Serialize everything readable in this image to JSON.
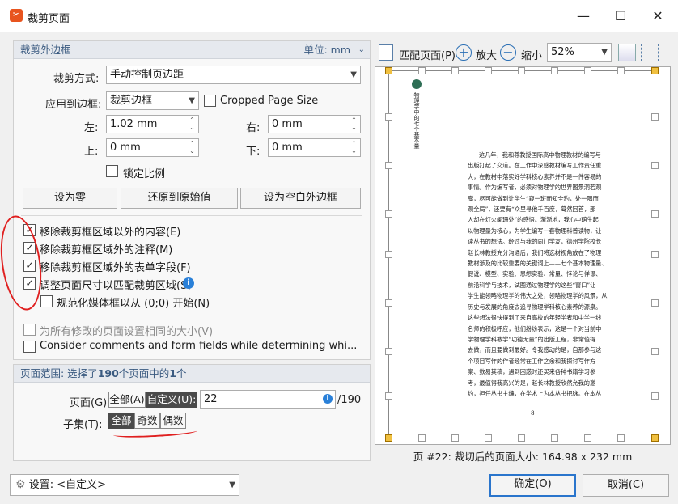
{
  "window": {
    "title": "裁剪页面",
    "minimize": "—",
    "maximize": "☐",
    "close": "✕",
    "app_icon": "foxit-icon"
  },
  "margins": {
    "header": "裁剪外边框",
    "unit_label": "单位:",
    "unit_value": "mm",
    "crop_mode_label": "裁剪方式:",
    "crop_mode_value": "手动控制页边距",
    "apply_to_label": "应用到边框:",
    "apply_to_value": "裁剪边框",
    "cropped_page_size_label": "Cropped Page Size",
    "left_label": "左:",
    "left_value": "1.02 mm",
    "right_label": "右:",
    "right_value": "0 mm",
    "top_label": "上:",
    "top_value": "0 mm",
    "bottom_label": "下:",
    "bottom_value": "0 mm",
    "lock_ratio_label": "锁定比例",
    "set_zero": "设为零",
    "revert": "还原到原始值",
    "set_to_white": "设为空白外边框"
  },
  "options": [
    {
      "label": "移除裁剪框区域以外的内容(E)",
      "checked": true,
      "disabled": false
    },
    {
      "label": "移除裁剪框区域外的注释(M)",
      "checked": true,
      "disabled": false
    },
    {
      "label": "移除裁剪框区域外的表单字段(F)",
      "checked": true,
      "disabled": false
    },
    {
      "label": "调整页面尺寸以匹配裁剪区域(S)",
      "checked": true,
      "disabled": false
    },
    {
      "label": "规范化媒体框以从 (0;0) 开始(N)",
      "checked": false,
      "disabled": false
    },
    {
      "label": "为所有修改的页面设置相同的大小(V)",
      "checked": false,
      "disabled": true
    },
    {
      "label": "Consider comments and form fields while determining whi...",
      "checked": false,
      "disabled": false
    }
  ],
  "range": {
    "header_prefix": "页面范围: 选择了",
    "header_count": "190",
    "header_mid": "个页面中的",
    "header_sel": "1",
    "header_suffix": "个",
    "pages_label": "页面(G):",
    "all": "全部(A)",
    "custom": "自定义(U):",
    "custom_value": "22",
    "total": "/190",
    "subset_label": "子集(T):",
    "subset_all": "全部",
    "subset_odd": "奇数",
    "subset_even": "偶数"
  },
  "settings": {
    "label": "设置:",
    "value": "<自定义>"
  },
  "buttons": {
    "ok": "确定(O)",
    "cancel": "取消(C)"
  },
  "preview": {
    "fit_page": "匹配页面(P)",
    "zoom_in": "放大",
    "zoom_out": "缩小",
    "zoom_value": "52%",
    "status": "页 #22: 裁切后的页面大小: 164.98 x 232 mm",
    "vertical_title": "物理学中的七个基本量",
    "page_number": "8",
    "lines": [
      "这几年，我和尊教授国际高中物理教材的编写与",
      "出版打起了交道。在工作中深感教材编写工作责任重",
      "大，在教材中落实好学科核心素养并不是一件容易的",
      "事情。作为编写者，必须对物理学的世界图景洞若观",
      "膨，尽可能做到让学生“窥一斑而知全豹，处一隅而",
      "观全局”，还要有“众里寻他千百度，蓦然回首，那",
      "人却在灯火阑珊处”的感悟。渐渐地，我心中萌生起",
      "以物理量为核心，为学生编写一套物理科普读物，让",
      "读丛书的想法。经过与我的同门学友，德州学院校长",
      "赵长林教授充分沟通后，我们将选材视角放在了物理",
      "教材涉及的比较重要的关键词上——七个基本物理量、",
      "假说、模型、实验、思想实验、常量、悖论与佯谬、",
      "前沿科学与技术，试图通过物理学的这些“窗口”让",
      "学生能领略物理学的伟大之处，领略物理学的风景，从",
      "历史与发展的角度去追寻物理学科核心素养的源泉。",
      "这些想法很快得到了来自高校的年轻学者和中学一线",
      "名师的积极呼应，他们纷纷表示，这是一个对当前中",
      "学物理学科教学“功德无量”的出版工程，非常值得",
      "去做，而且要做到最好。令我感动的是，自那参与这",
      "个项目写作的作者经常在工作之余和我探讨写作方",
      "案、数易其稿，遇到困惑时还买来各种书籍学习参",
      "考，最值得我高兴的是，赵长林教授欣然允我的邀",
      "约，担任丛书主编，在学术上为本丛书把脉。在本丛"
    ]
  }
}
